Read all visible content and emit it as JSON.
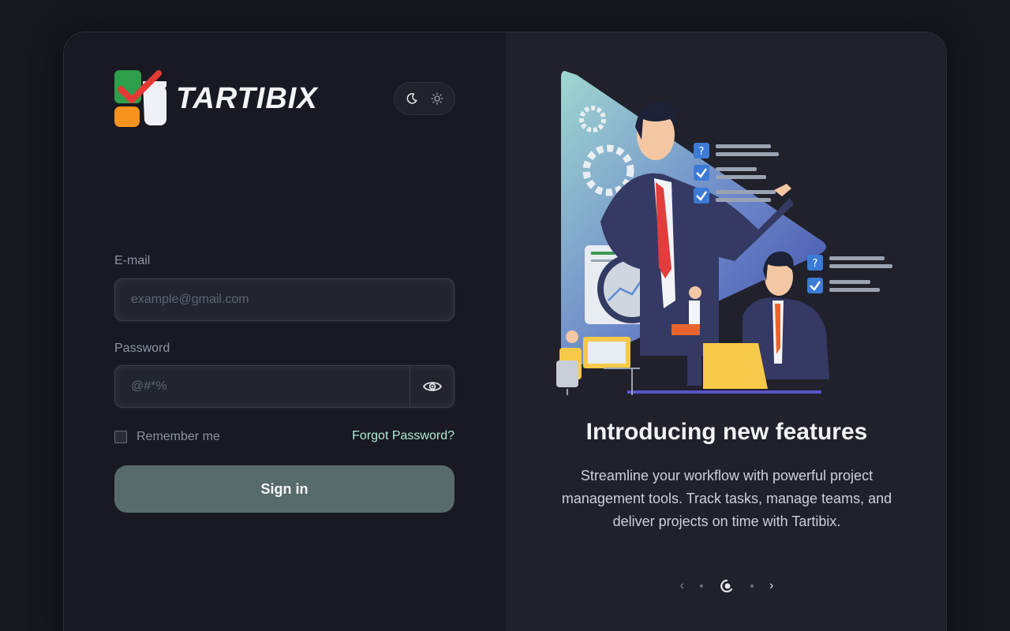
{
  "brand": {
    "name": "TARTIBIX"
  },
  "theme_toggle": {
    "dark_icon": "moon-icon",
    "light_icon": "sun-icon"
  },
  "form": {
    "email_label": "E-mail",
    "email_placeholder": "example@gmail.com",
    "password_label": "Password",
    "password_placeholder": "@#*%",
    "remember_label": "Remember me",
    "forgot_label": "Forgot Password?",
    "signin_label": "Sign in"
  },
  "promo": {
    "title": "Introducing new features",
    "description": "Streamline your workflow with powerful project management tools. Track tasks, manage teams, and deliver projects on time with Tartibix."
  },
  "carousel": {
    "prev_icon": "chevron-left-icon",
    "next_icon": "chevron-right-icon",
    "slide_count": 3,
    "active_index": 1
  },
  "colors": {
    "accent_mint": "#b3ead8",
    "signin_bg": "#586b6c",
    "logo_green": "#2e9e4a",
    "logo_red": "#e53935",
    "logo_orange": "#f5931e"
  }
}
